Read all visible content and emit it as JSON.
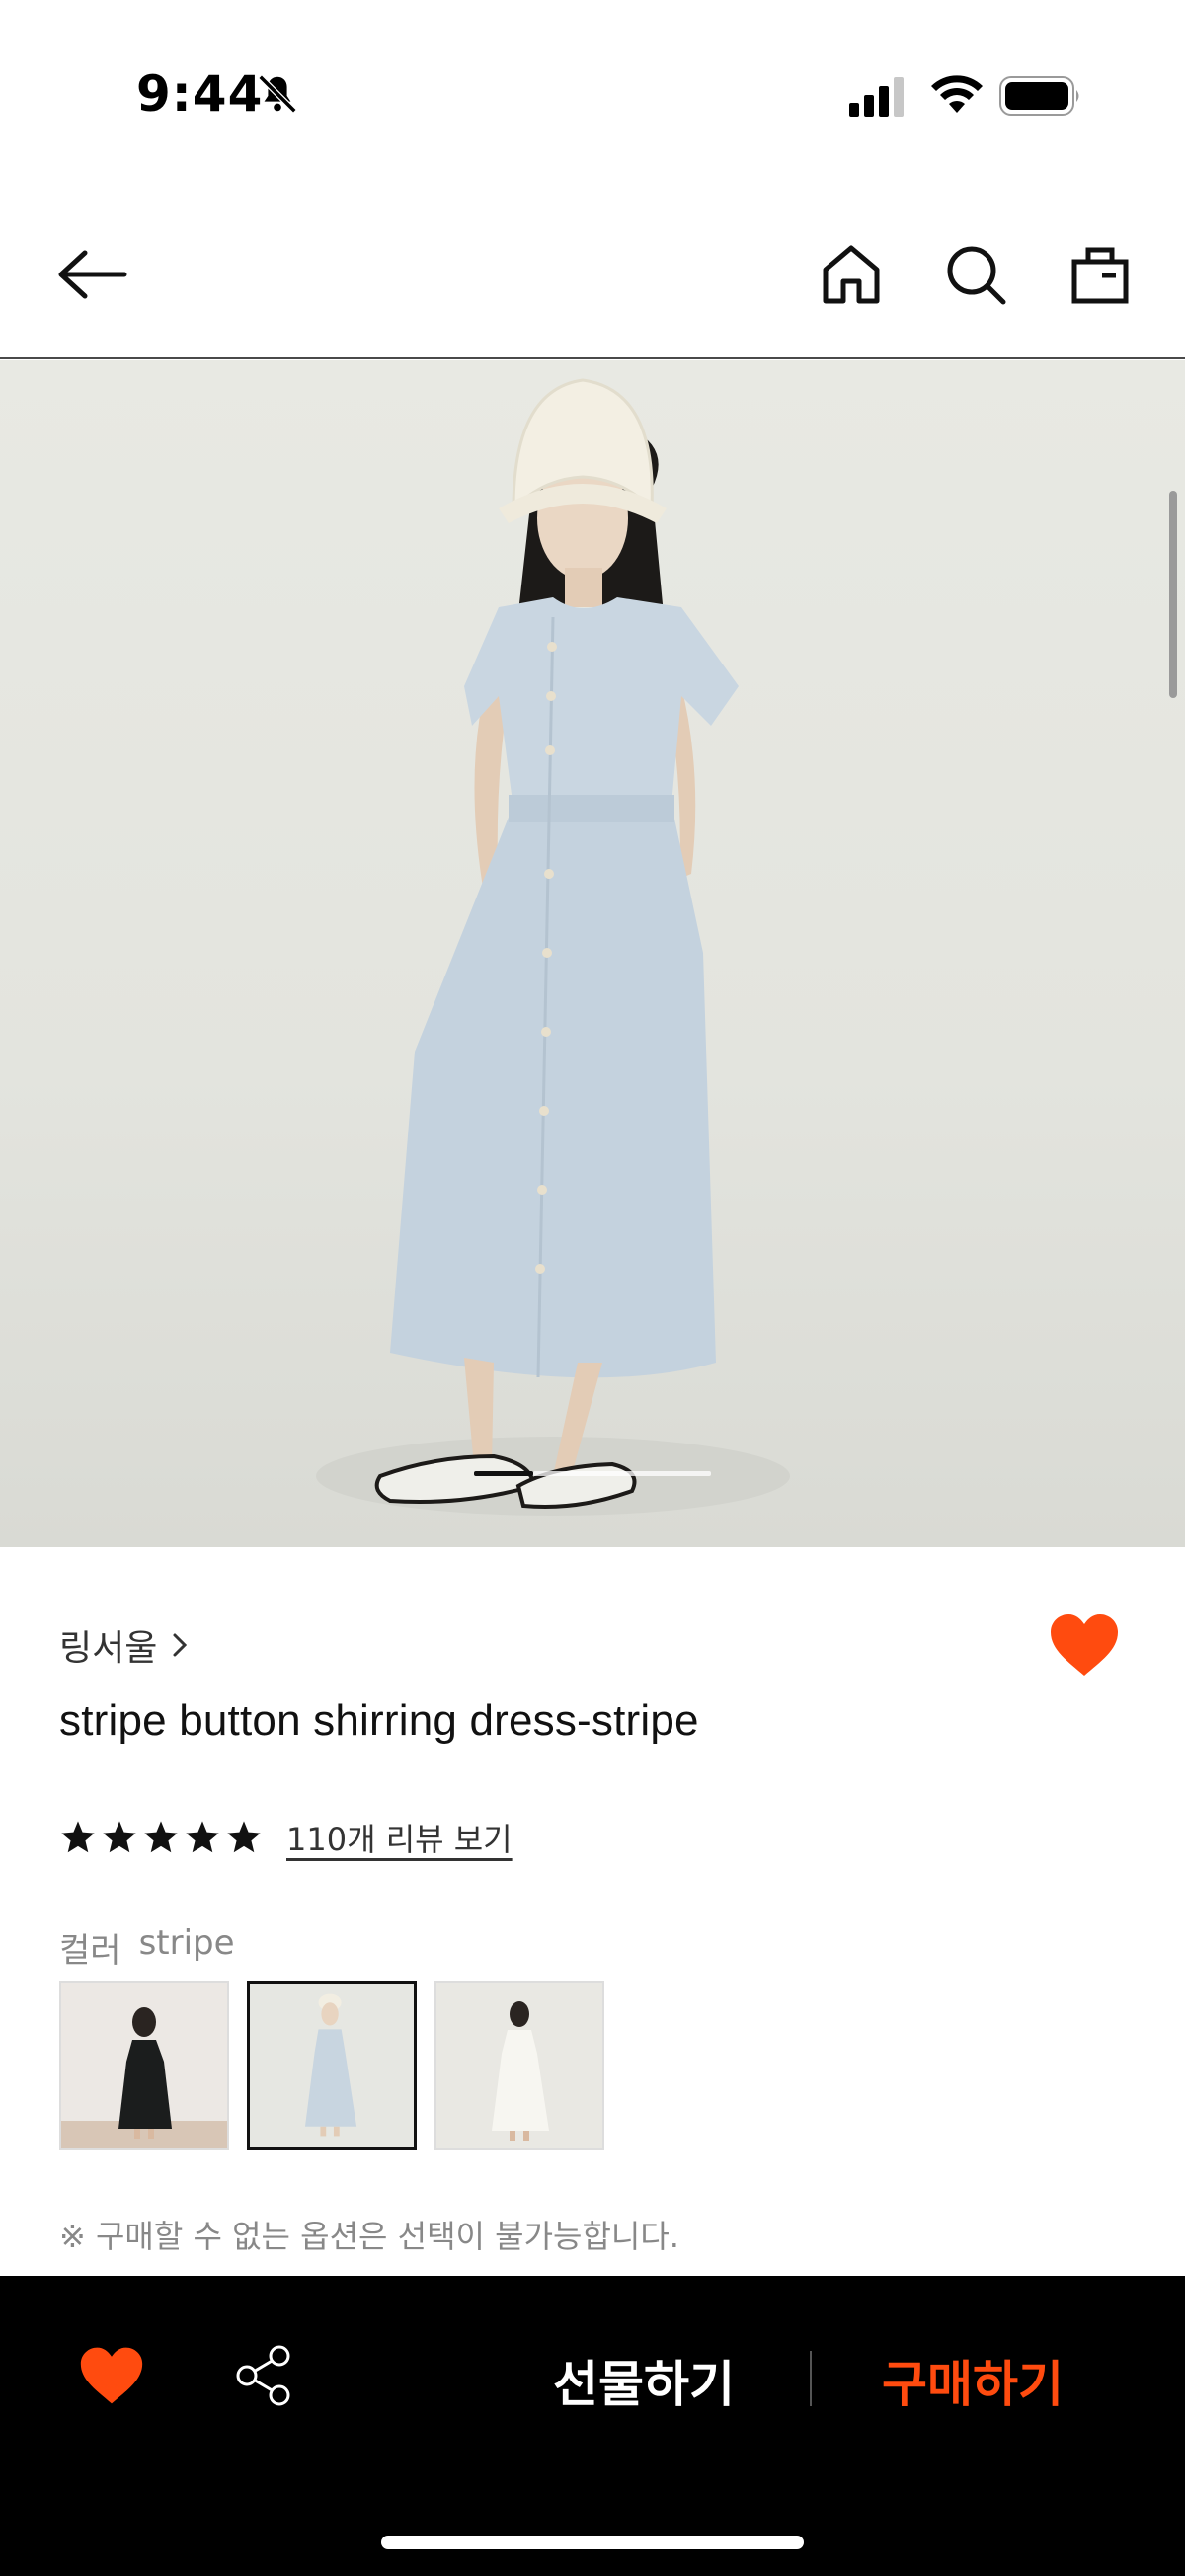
{
  "status_bar": {
    "time": "9:44"
  },
  "colors": {
    "accent": "#ff4b0f",
    "bottom_bar": "#000000",
    "text": "#111111",
    "muted": "#888888"
  },
  "nav": {
    "back_icon": "arrow-left-icon",
    "home_icon": "home-icon",
    "search_icon": "search-icon",
    "bag_icon": "shopping-bag-icon"
  },
  "hero": {
    "image_count": 4,
    "current_index": 1
  },
  "product": {
    "brand": "링서울",
    "title": "stripe button shirring dress-stripe",
    "rating_stars": 5,
    "review_link": "110개 리뷰 보기",
    "favorited": true
  },
  "color_option": {
    "label": "컬러",
    "selected": "stripe",
    "swatches": [
      {
        "name": "black",
        "selected": false
      },
      {
        "name": "stripe",
        "selected": true
      },
      {
        "name": "ivory",
        "selected": false
      }
    ]
  },
  "notice": "※ 구매할 수 없는 옵션은 선택이 불가능합니다.",
  "bottom_bar": {
    "gift_label": "선물하기",
    "buy_label": "구매하기"
  }
}
